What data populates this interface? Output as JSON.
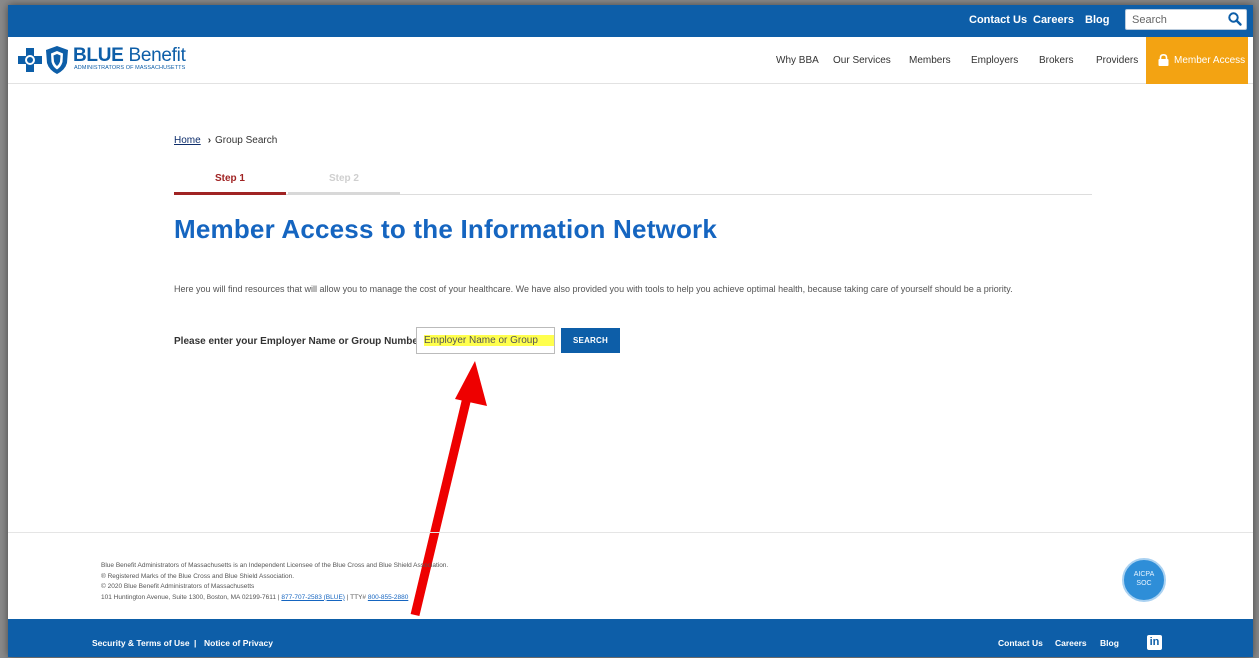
{
  "utility": {
    "contact": "Contact Us",
    "careers": "Careers",
    "blog": "Blog",
    "search_placeholder": "Search",
    "search_icon": "search-icon"
  },
  "logo": {
    "title_bold": "BLUE",
    "title_rest": " Benefit",
    "subtitle": "ADMINISTRATORS OF MASSACHUSETTS"
  },
  "nav": {
    "items": [
      "Why BBA",
      "Our Services",
      "Members",
      "Employers",
      "Brokers",
      "Providers"
    ],
    "member_access": "Member Access",
    "member_access_icon": "lock-icon"
  },
  "breadcrumb": {
    "home": "Home",
    "current": "Group Search"
  },
  "steps": [
    "Step 1",
    "Step 2"
  ],
  "page": {
    "title": "Member Access to the Information Network",
    "intro": "Here you will find resources that will allow you to manage the cost of your healthcare. We have also provided you with tools to help you achieve optimal health, because taking care of yourself should be a priority."
  },
  "form": {
    "label": "Please enter your Employer Name or Group Number:",
    "placeholder": "Employer Name or Group",
    "button": "SEARCH"
  },
  "footer": {
    "line1": "Blue Benefit Administrators of Massachusetts is an Independent Licensee of the Blue Cross and Blue Shield Association.",
    "line2": "® Registered Marks of the Blue Cross and Blue Shield Association.",
    "line3": "© 2020 Blue Benefit Administrators of Massachusetts",
    "line4_prefix": "101 Huntington Avenue, Suite 1300, Boston, MA 02199-7611 | ",
    "phone": "877-707-2583 (BLUE)",
    "tty_prefix": " | TTY# ",
    "tty": "800-855-2880",
    "badge_line1": "AICPA",
    "badge_line2": "SOC",
    "security": "Security & Terms of Use",
    "separator": "|",
    "privacy": "Notice of Privacy",
    "contact": "Contact Us",
    "careers": "Careers",
    "blog": "Blog",
    "linkedin": "in"
  },
  "colors": {
    "brand_blue": "#0d5ea8",
    "title_blue": "#1565c0",
    "accent_orange": "#f3a312",
    "step_active": "#a02323",
    "highlight": "#ffff4d",
    "annotation_arrow": "#ee0000"
  }
}
